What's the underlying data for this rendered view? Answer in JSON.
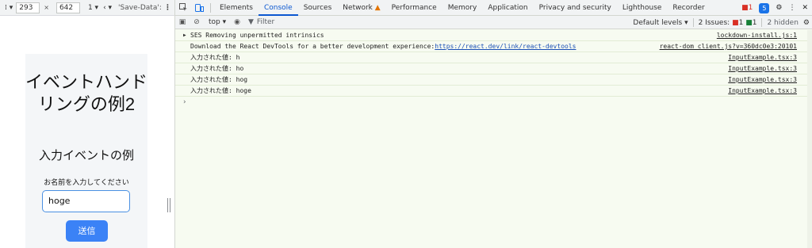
{
  "device_toolbar": {
    "menu": "⁞ ▾",
    "width": "293",
    "height": "642",
    "times": "×",
    "zoom": "1 ▾",
    "throttle": "‹ ▾",
    "save_data": "'Save-Data': d",
    "more": "⋮"
  },
  "preview": {
    "heading": "イベントハンドリングの例2",
    "subheading": "入力イベントの例",
    "input_label": "お名前を入力してください",
    "input_value": "hoge",
    "submit_label": "送信"
  },
  "tabs": [
    {
      "label": "Elements"
    },
    {
      "label": "Console",
      "active": true
    },
    {
      "label": "Sources"
    },
    {
      "label": "Network"
    },
    {
      "label": "Performance"
    },
    {
      "label": "Memory"
    },
    {
      "label": "Application"
    },
    {
      "label": "Privacy and security"
    },
    {
      "label": "Lighthouse"
    },
    {
      "label": "Recorder"
    }
  ],
  "topbar_right": {
    "error_count": "1",
    "profile_initial": "5"
  },
  "console_toolbar": {
    "context": "top ▾",
    "filter_placeholder": "Filter",
    "levels": "Default levels ▾",
    "issues_label": "2 Issues:",
    "issues_errors": "1",
    "issues_info": "1",
    "hidden": "2 hidden"
  },
  "console_rows": [
    {
      "message": "SES Removing unpermitted intrinsics",
      "source": "lockdown-install.js:1",
      "triangle": true
    },
    {
      "message": "Download the React DevTools for a better development experience: ",
      "link": "https://react.dev/link/react-devtools",
      "source": "react-dom_client.js?v=360dc0e3:20101"
    },
    {
      "message": "入力された値: h",
      "source": "InputExample.tsx:3"
    },
    {
      "message": "入力された値: ho",
      "source": "InputExample.tsx:3"
    },
    {
      "message": "入力された値: hog",
      "source": "InputExample.tsx:3"
    },
    {
      "message": "入力された値: hoge",
      "source": "InputExample.tsx:3"
    }
  ],
  "colors": {
    "accent": "#0b57d0",
    "console_bg": "#f7fbf1",
    "button": "#3b82f6",
    "error": "#d93025"
  }
}
